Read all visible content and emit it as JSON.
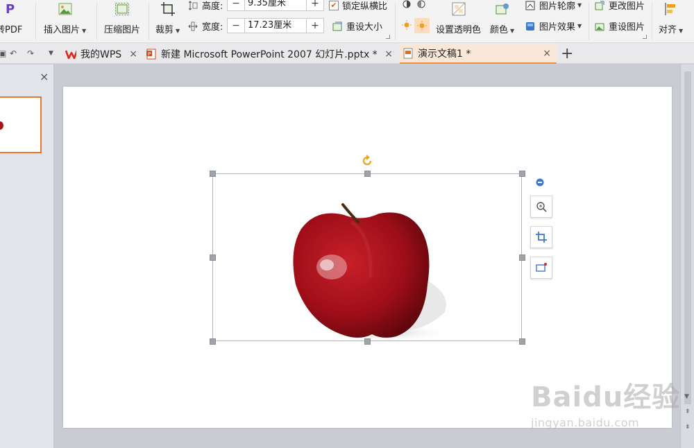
{
  "ribbon": {
    "to_pdf": "转PDF",
    "insert_picture": "插入图片",
    "compress_picture": "压缩图片",
    "crop": "裁剪",
    "height_label": "高度:",
    "height_value": "9.35厘米",
    "width_label": "宽度:",
    "width_value": "17.23厘米",
    "lock_aspect": "锁定纵横比",
    "reset_size": "重设大小",
    "set_transparent": "设置透明色",
    "color": "颜色",
    "picture_outline": "图片轮廓",
    "picture_effects": "图片效果",
    "change_picture": "更改图片",
    "reset_picture": "重设图片",
    "align": "对齐",
    "minus": "−",
    "plus": "+"
  },
  "tabs": [
    {
      "label": "我的WPS",
      "icon": "wps-logo-icon"
    },
    {
      "label": "新建 Microsoft PowerPoint 2007 幻灯片.pptx *",
      "icon": "pptx-file-icon"
    },
    {
      "label": "演示文稿1 *",
      "icon": "presentation-file-icon",
      "active": true
    }
  ],
  "watermark": {
    "logo": "Baidu经验",
    "url": "jingyan.baidu.com"
  },
  "colors": {
    "accent": "#ef8e3a",
    "apple": "#a8121a",
    "wps_red": "#d9281c"
  }
}
